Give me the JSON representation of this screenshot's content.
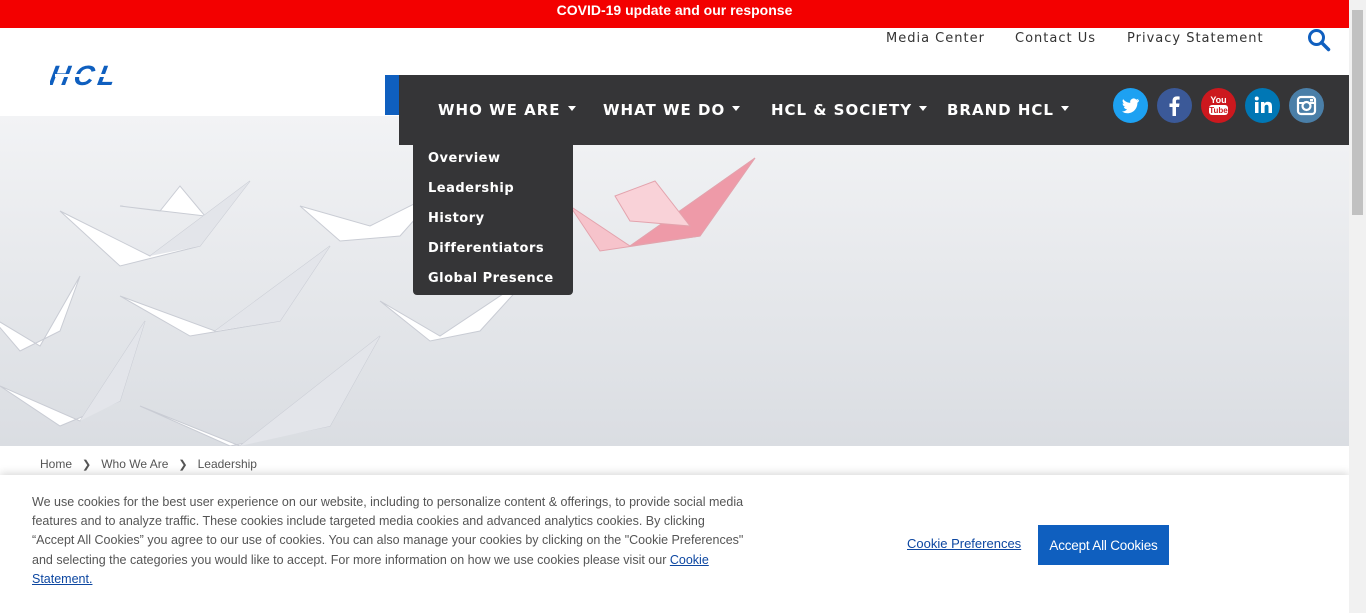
{
  "banner": {
    "covid_text": "COVID-19 update and our response"
  },
  "utility_nav": {
    "items": [
      "Media Center",
      "Contact Us",
      "Privacy Statement"
    ]
  },
  "logo": {
    "text": "HCL",
    "color": "#0f5fbf"
  },
  "main_nav": {
    "items": [
      {
        "label": "WHO WE ARE"
      },
      {
        "label": "WHAT WE DO"
      },
      {
        "label": "HCL & SOCIETY"
      },
      {
        "label": "BRAND HCL"
      }
    ],
    "background": "#353537"
  },
  "social": [
    {
      "name": "twitter-icon",
      "color": "#1da1f2"
    },
    {
      "name": "facebook-icon",
      "color": "#3b5998"
    },
    {
      "name": "youtube-icon",
      "color": "#cc181e"
    },
    {
      "name": "linkedin-icon",
      "color": "#0077b5"
    },
    {
      "name": "instagram-icon",
      "color": "#4a7fa8"
    }
  ],
  "dropdown": {
    "items": [
      "Overview",
      "Leadership",
      "History",
      "Differentiators",
      "Global Presence"
    ]
  },
  "breadcrumb": [
    "Home",
    "Who We Are",
    "Leadership"
  ],
  "cookie": {
    "text": "We use cookies for the best user experience on our website, including to personalize content & offerings, to provide social media features and to analyze traffic. These cookies include targeted media cookies and advanced analytics cookies. By clicking “Accept All Cookies” you agree to our use of cookies. You can also manage your cookies by clicking on the \"Cookie Preferences\" and selecting the categories you would like to accept. For more information on how we use cookies please visit our",
    "statement_link": "Cookie Statement.",
    "preferences_label": "Cookie Preferences",
    "accept_label": "Accept All Cookies"
  }
}
